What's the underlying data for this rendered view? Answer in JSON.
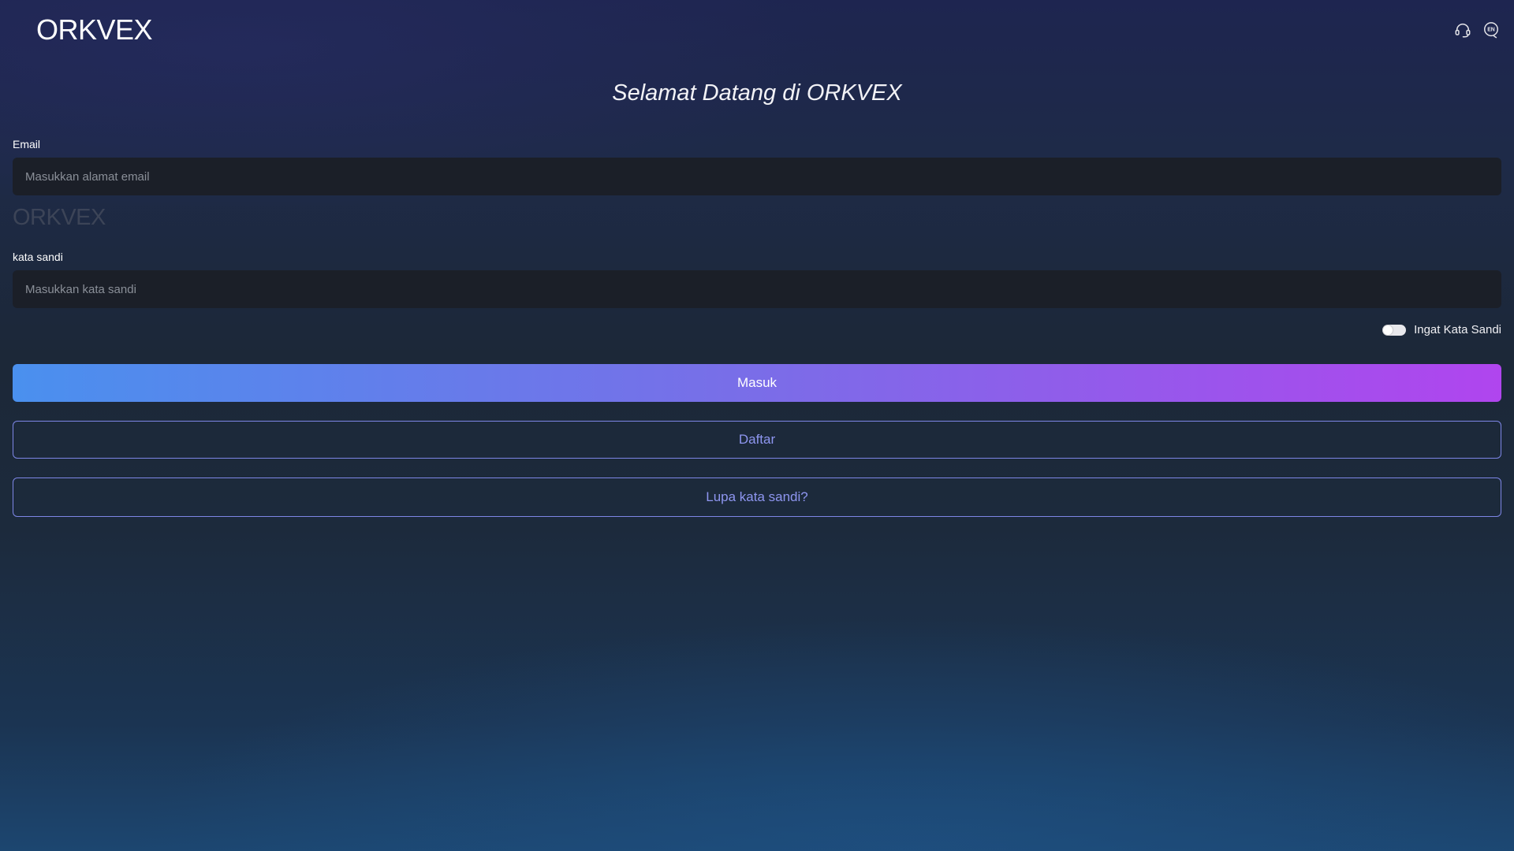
{
  "header": {
    "logo": "ORKVEX",
    "icons": [
      "support-headset-icon",
      "language-en-icon"
    ],
    "language_badge": "EN"
  },
  "title": "Selamat Datang di ORKVEX",
  "form": {
    "email_label": "Email",
    "email_placeholder": "Masukkan alamat email",
    "email_value": "",
    "watermark": "ORKVEX",
    "password_label": "kata sandi",
    "password_placeholder": "Masukkan kata sandi",
    "password_value": "",
    "remember_label": "Ingat Kata Sandi",
    "remember_checked": false
  },
  "buttons": {
    "login": "Masuk",
    "register": "Daftar",
    "forgot": "Lupa kata sandi?"
  },
  "colors": {
    "primary_gradient_start": "#4a90ee",
    "primary_gradient_end": "#b045ee",
    "outline_accent": "#7d86e6",
    "input_background": "#1b1f28"
  }
}
